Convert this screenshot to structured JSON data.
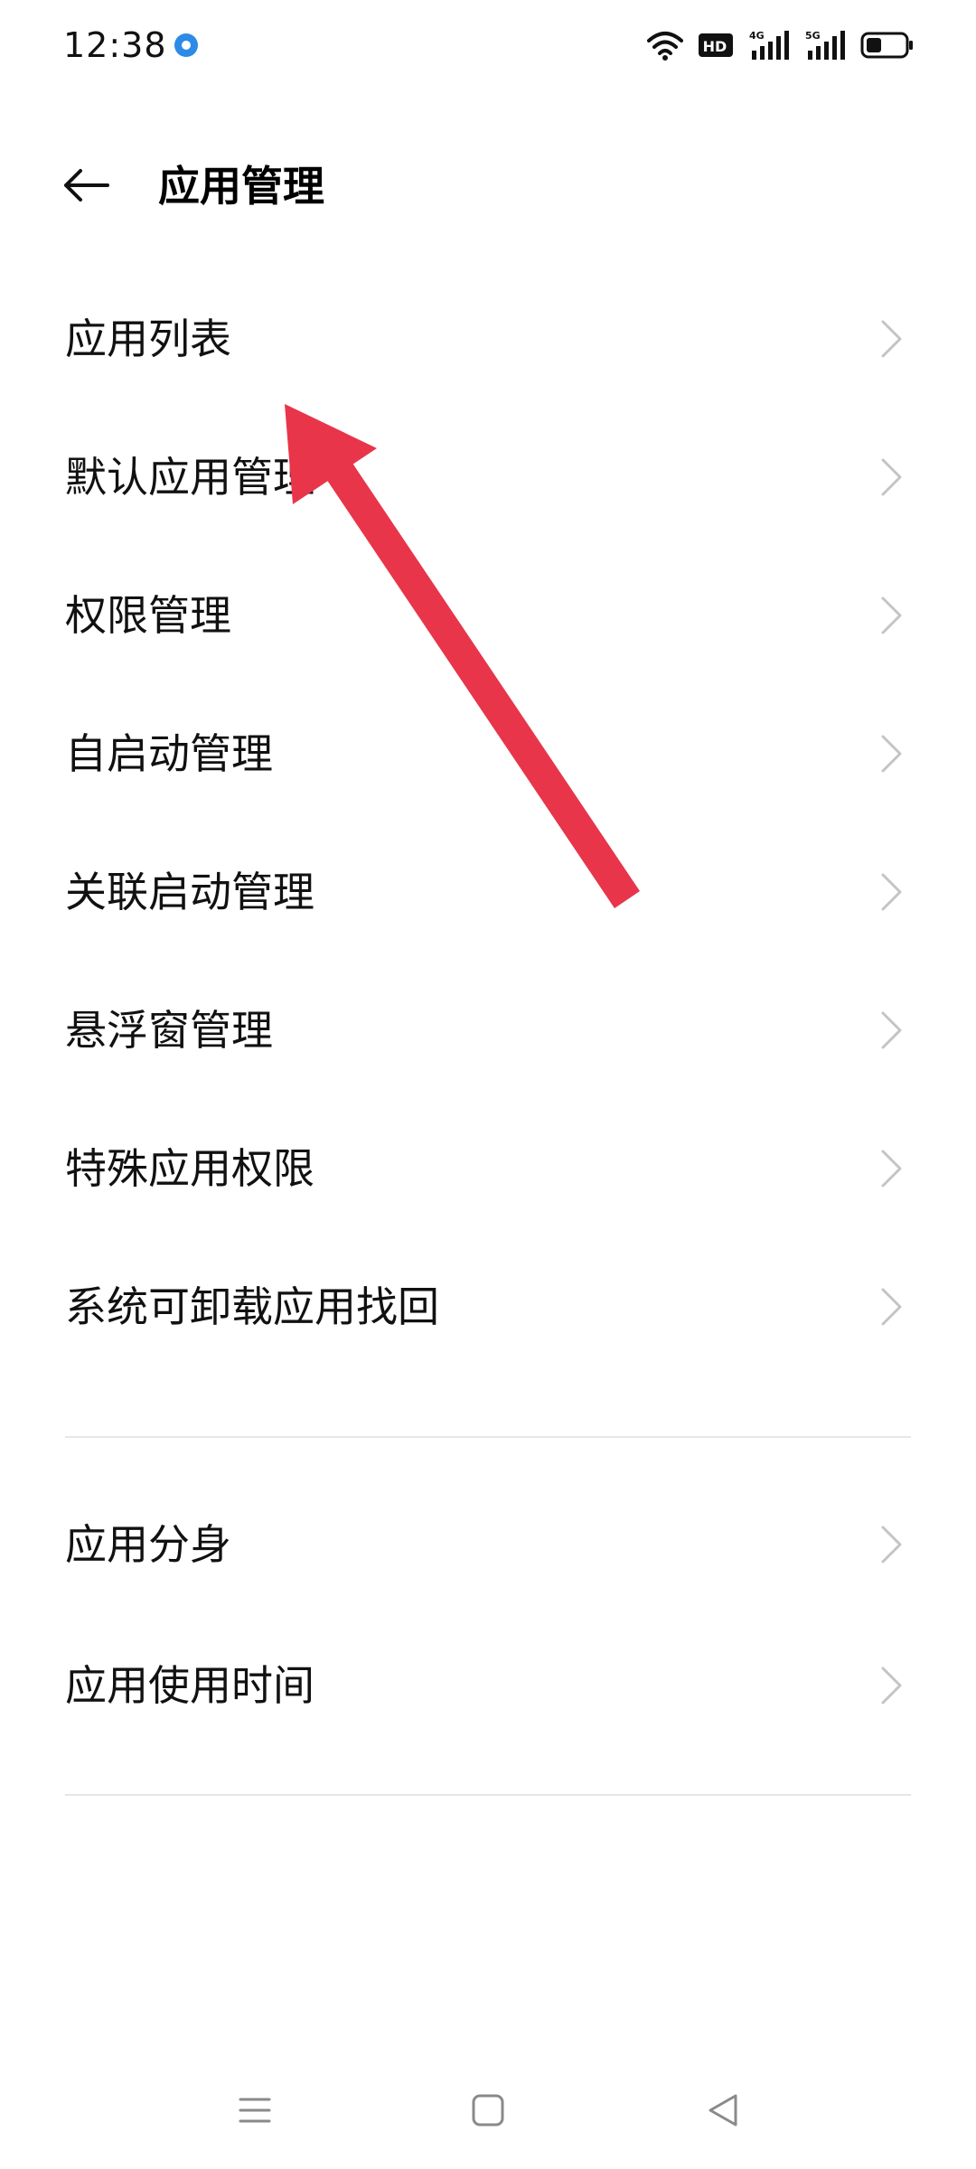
{
  "status_bar": {
    "time": "12:38",
    "icons": [
      "wifi-icon",
      "hd-icon",
      "signal-4g-icon",
      "signal-5g-icon",
      "battery-icon"
    ],
    "hd_label": "HD",
    "network_4g": "4G",
    "network_5g": "5G"
  },
  "header": {
    "title": "应用管理"
  },
  "menu": {
    "group1": [
      {
        "label": "应用列表"
      },
      {
        "label": "默认应用管理"
      },
      {
        "label": "权限管理"
      },
      {
        "label": "自启动管理"
      },
      {
        "label": "关联启动管理"
      },
      {
        "label": "悬浮窗管理"
      },
      {
        "label": "特殊应用权限"
      },
      {
        "label": "系统可卸载应用找回"
      }
    ],
    "group2": [
      {
        "label": "应用分身"
      },
      {
        "label": "应用使用时间"
      }
    ]
  },
  "colors": {
    "annotation_arrow": "#e8354a",
    "accent_dot": "#2b8be6",
    "divider": "#e6e6e6",
    "chevron": "#c4c4c4"
  },
  "nav_bar": {
    "icons": [
      "menu-icon",
      "home-icon",
      "back-triangle-icon"
    ]
  }
}
